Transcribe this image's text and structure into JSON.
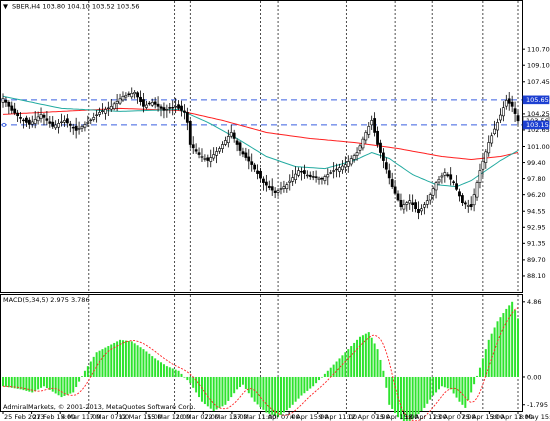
{
  "chart_data": [
    {
      "type": "candlestick",
      "symbol_line": "SBER,H4  103.80 104.10 103.52 103.56",
      "ylim": [
        86.5,
        115.5
      ],
      "yticks": [
        "110.70",
        "109.10",
        "107.45",
        "105.80",
        "104.25",
        "102.65",
        "101.00",
        "99.40",
        "97.80",
        "96.20",
        "94.55",
        "92.95",
        "91.35",
        "89.70",
        "88.10"
      ],
      "xticks": [
        "25 Feb 2013",
        "27 Feb 15:00",
        "4 Mar 11:00",
        "7 Mar 07:00",
        "12 Mar 15:00",
        "15 Mar 11:00",
        "20 Mar 07:00",
        "22 Mar 15:00",
        "27 Mar 11:00",
        "1 Apr 07:00",
        "4 Apr 15:00",
        "9 Apr 11:00",
        "12 Apr 07:00",
        "15 Apr 15:00",
        "18 Apr 11:00",
        "23 Apr 07:00",
        "25 Apr 15:00",
        "30 Apr 11:00",
        "8 May 15:00"
      ],
      "price_badges": [
        {
          "label": "105.65",
          "value": 105.65,
          "color": "#1c3fd1"
        },
        {
          "label": "103.56",
          "value": 103.56,
          "color": "#ffffff"
        },
        {
          "label": "103.15",
          "value": 103.15,
          "color": "#1c3fd1"
        }
      ],
      "hlines": [
        {
          "value": 105.65,
          "color": "#3a5fe0",
          "style": "dash"
        },
        {
          "value": 103.15,
          "color": "#3a5fe0",
          "style": "dash"
        }
      ],
      "close_anchors": [
        [
          0,
          105.8
        ],
        [
          3,
          104.6
        ],
        [
          6,
          103.8
        ],
        [
          9,
          103.2
        ],
        [
          13,
          104.2
        ],
        [
          17,
          103.0
        ],
        [
          21,
          103.6
        ],
        [
          25,
          102.6
        ],
        [
          29,
          103.4
        ],
        [
          33,
          104.4
        ],
        [
          37,
          105.0
        ],
        [
          41,
          106.0
        ],
        [
          45,
          106.4
        ],
        [
          48,
          105.0
        ],
        [
          51,
          105.4
        ],
        [
          55,
          104.6
        ],
        [
          59,
          105.0
        ],
        [
          62,
          104.4
        ],
        [
          63,
          103.4
        ],
        [
          64,
          101.2
        ],
        [
          67,
          100.2
        ],
        [
          70,
          99.6
        ],
        [
          74,
          100.8
        ],
        [
          78,
          102.4
        ],
        [
          81,
          100.6
        ],
        [
          85,
          99.2
        ],
        [
          89,
          97.4
        ],
        [
          93,
          96.4
        ],
        [
          97,
          97.2
        ],
        [
          101,
          98.6
        ],
        [
          105,
          98.0
        ],
        [
          109,
          97.8
        ],
        [
          113,
          98.6
        ],
        [
          117,
          99.2
        ],
        [
          121,
          100.4
        ],
        [
          124,
          102.4
        ],
        [
          126,
          103.6
        ],
        [
          128,
          101.2
        ],
        [
          130,
          99.6
        ],
        [
          133,
          97.0
        ],
        [
          136,
          95.0
        ],
        [
          139,
          95.6
        ],
        [
          142,
          94.4
        ],
        [
          145,
          95.6
        ],
        [
          148,
          97.4
        ],
        [
          151,
          98.4
        ],
        [
          154,
          97.4
        ],
        [
          157,
          95.4
        ],
        [
          160,
          95.0
        ],
        [
          163,
          98.6
        ],
        [
          166,
          101.4
        ],
        [
          169,
          103.4
        ],
        [
          172,
          105.6
        ],
        [
          174,
          105.0
        ],
        [
          176,
          103.56
        ]
      ],
      "ma_green_anchors": [
        [
          0,
          106.0
        ],
        [
          20,
          104.8
        ],
        [
          40,
          104.5
        ],
        [
          60,
          104.7
        ],
        [
          70,
          103.4
        ],
        [
          80,
          101.8
        ],
        [
          90,
          100.0
        ],
        [
          100,
          99.0
        ],
        [
          110,
          98.8
        ],
        [
          120,
          99.6
        ],
        [
          126,
          100.4
        ],
        [
          132,
          99.8
        ],
        [
          140,
          98.2
        ],
        [
          148,
          97.2
        ],
        [
          155,
          97.0
        ],
        [
          160,
          97.6
        ],
        [
          165,
          98.6
        ],
        [
          170,
          99.6
        ],
        [
          176,
          100.6
        ]
      ],
      "ma_red_anchors": [
        [
          0,
          104.2
        ],
        [
          20,
          104.5
        ],
        [
          40,
          104.8
        ],
        [
          60,
          104.6
        ],
        [
          75,
          103.6
        ],
        [
          90,
          102.4
        ],
        [
          105,
          101.8
        ],
        [
          120,
          101.4
        ],
        [
          135,
          100.8
        ],
        [
          150,
          100.0
        ],
        [
          160,
          99.7
        ],
        [
          170,
          100.0
        ],
        [
          176,
          100.4
        ]
      ],
      "colors": {
        "bull": "#ffffff",
        "bear": "#000000",
        "wick": "#000000",
        "ma_green": "#22aaa0",
        "ma_red": "#ff2020",
        "grid": "#000000",
        "frame": "#000000"
      }
    },
    {
      "type": "bar",
      "title": "MACD(5,34,5) 2.975 3.786",
      "ylim": [
        -2.2,
        5.3
      ],
      "yticks": [
        "4.86",
        "0.00",
        "-1.795"
      ],
      "histogram_anchors": [
        [
          0,
          -0.6
        ],
        [
          6,
          -0.8
        ],
        [
          10,
          -1.0
        ],
        [
          14,
          -0.6
        ],
        [
          20,
          -1.3
        ],
        [
          24,
          -1.0
        ],
        [
          28,
          0.4
        ],
        [
          32,
          1.6
        ],
        [
          36,
          2.0
        ],
        [
          40,
          2.4
        ],
        [
          44,
          2.3
        ],
        [
          48,
          1.8
        ],
        [
          52,
          1.2
        ],
        [
          56,
          0.7
        ],
        [
          60,
          0.4
        ],
        [
          64,
          -0.4
        ],
        [
          68,
          -1.6
        ],
        [
          72,
          -2.2
        ],
        [
          76,
          -1.8
        ],
        [
          80,
          -0.8
        ],
        [
          82,
          -0.5
        ],
        [
          86,
          -1.6
        ],
        [
          90,
          -2.3
        ],
        [
          94,
          -2.6
        ],
        [
          98,
          -2.0
        ],
        [
          102,
          -1.2
        ],
        [
          106,
          -0.6
        ],
        [
          110,
          0.2
        ],
        [
          114,
          1.0
        ],
        [
          118,
          1.8
        ],
        [
          122,
          2.6
        ],
        [
          125,
          2.9
        ],
        [
          128,
          1.8
        ],
        [
          130,
          0.4
        ],
        [
          132,
          -1.8
        ],
        [
          135,
          -2.6
        ],
        [
          138,
          -3.0
        ],
        [
          141,
          -2.6
        ],
        [
          144,
          -2.0
        ],
        [
          147,
          -1.2
        ],
        [
          150,
          -0.6
        ],
        [
          153,
          -0.8
        ],
        [
          156,
          -1.6
        ],
        [
          158,
          -2.0
        ],
        [
          160,
          -1.0
        ],
        [
          163,
          0.6
        ],
        [
          166,
          2.4
        ],
        [
          169,
          3.6
        ],
        [
          172,
          4.4
        ],
        [
          174,
          4.86
        ],
        [
          176,
          3.786
        ]
      ],
      "signal_lag": 3,
      "colors": {
        "hist": "#2ee32e",
        "signal": "#ff2020"
      }
    }
  ],
  "footer": "AdmiralMarkets, © 2001-2013, MetaQuotes Software Corp."
}
